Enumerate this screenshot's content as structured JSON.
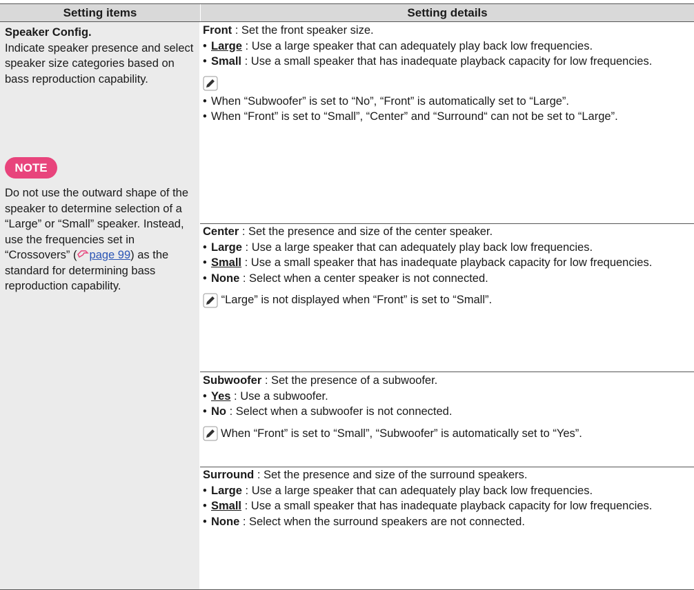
{
  "header": {
    "col1": "Setting items",
    "col2": "Setting details"
  },
  "left": {
    "title": "Speaker Config.",
    "desc": "Indicate speaker presence and select speaker size categories based on bass reproduction capability.",
    "note_label": "NOTE",
    "note_part1": "Do not use the outward shape of the speaker to determine selection of a “Large” or “Small” speaker. Instead, use the frequencies set in “Crossovers” (",
    "note_link": "page 99",
    "note_part2": ") as the standard for determining bass reproduction capability."
  },
  "front": {
    "label": "Front",
    "desc": " : Set the front speaker size.",
    "b1_label": "Large",
    "b1_text": " : Use a large speaker that can adequately play back low frequencies.",
    "b2_label": "Small",
    "b2_text": " : Use a small speaker that has inadequate playback capacity for low frequencies.",
    "n1": "When “Subwoofer” is set to “No”, “Front” is automatically set to “Large”.",
    "n2": "When “Front” is set to “Small”, “Center” and “Surround“ can not be set to “Large”."
  },
  "center": {
    "label": "Center",
    "desc": " : Set the presence and size of the center speaker.",
    "b1_label": "Large",
    "b1_text": " : Use a large speaker that can adequately play back low frequencies.",
    "b2_label": "Small",
    "b2_text": " : Use a small speaker that has inadequate playback capacity for low frequencies.",
    "b3_label": "None",
    "b3_text": " : Select when a center speaker is not connected.",
    "note": "“Large” is not displayed when “Front” is set to “Small”."
  },
  "subwoofer": {
    "label": "Subwoofer",
    "desc": " : Set the presence of a subwoofer.",
    "b1_label": "Yes",
    "b1_text": " : Use a subwoofer.",
    "b2_label": "No",
    "b2_text": " : Select when a subwoofer is not connected.",
    "note": "When “Front” is set to “Small”, “Subwoofer” is automatically set to “Yes”."
  },
  "surround": {
    "label": "Surround",
    "desc": " : Set the presence and size of the surround speakers.",
    "b1_label": "Large",
    "b1_text": " : Use a large speaker that can adequately play back low frequencies.",
    "b2_label": "Small",
    "b2_text": " : Use a small speaker that has inadequate playback capacity for low frequencies.",
    "b3_label": "None",
    "b3_text": " : Select when the surround speakers are not connected."
  }
}
